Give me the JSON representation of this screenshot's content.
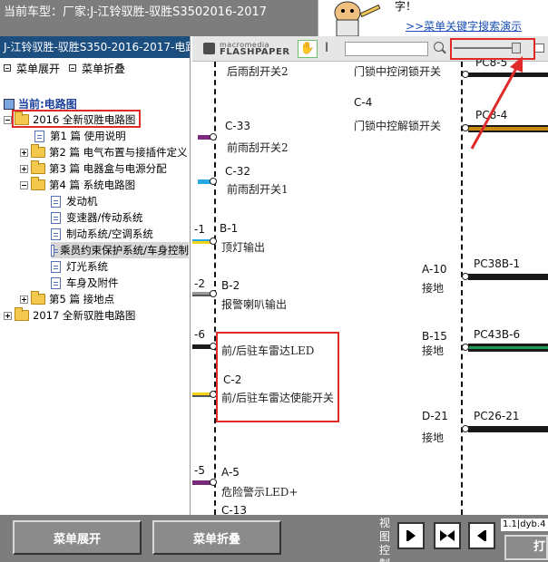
{
  "window": {
    "title": "当前车型：厂家:J-江铃驭胜-驭胜S3502016-2017"
  },
  "banner": {
    "tip": "字！",
    "link": ">>菜单关键字搜索演示"
  },
  "left_panel": {
    "header": "J-江铃驭胜-驭胜S350-2016-2017-电路",
    "expand_label": "菜单展开",
    "collapse_label": "菜单折叠",
    "current_label": "当前:电路图",
    "tree": [
      {
        "label": "2016 全新驭胜电路图"
      },
      {
        "label": "第1 篇 使用说明"
      },
      {
        "label": "第2 篇 电气布置与接插件定义"
      },
      {
        "label": "第3 篇 电器盒与电源分配"
      },
      {
        "label": "第4 篇 系统电路图"
      },
      {
        "label": "发动机"
      },
      {
        "label": "变速器/传动系统"
      },
      {
        "label": "制动系统/空调系统"
      },
      {
        "label": "乘员约束保护系统/车身控制"
      },
      {
        "label": "灯光系统"
      },
      {
        "label": "车身及附件"
      },
      {
        "label": "第5 篇 接地点"
      },
      {
        "label": "2017 全新驭胜电路图"
      }
    ]
  },
  "viewer": {
    "logo_top": "macromedia",
    "logo_main": "FLASHPAPER",
    "cursor_glyph": "I"
  },
  "diagram": {
    "left_codes": [
      "C-33",
      "C-32",
      "B-1",
      "B-2",
      "C-2",
      "A-5",
      "C-13"
    ],
    "left_labels": [
      "后雨刮开关2",
      "前雨刮开关2",
      "前雨刮开关1",
      "顶灯输出",
      "报警喇叭输出",
      "前/后驻车雷达LED",
      "前/后驻车雷达使能开关",
      "危险警示LED+"
    ],
    "pin_numbers": [
      "-1",
      "-2",
      "-6",
      "-5"
    ],
    "mid_codes": [
      "C-4",
      "A-10",
      "B-15",
      "D-21"
    ],
    "mid_labels": [
      "门锁中控闭锁开关",
      "门锁中控解锁开关",
      "接地",
      "接地",
      "接地"
    ],
    "wire_codes": [
      "PC8-5",
      "PC8-4",
      "PC38B-1",
      "PC43B-6",
      "PC26-21"
    ],
    "colors": {
      "purple": "#7a2a7a",
      "cyan": "#25a9e0",
      "yellow": "#f2d21b",
      "gray": "#9a9a9a",
      "black": "#1a1a1a",
      "orange": "#c98a12",
      "green": "#1e9a55",
      "red_annotation": "#e02a2a"
    }
  },
  "bottom_bar": {
    "expand_button": "菜单展开",
    "collapse_button": "菜单折叠",
    "view_control": "视图控制",
    "page_info": "1.1|dyb.4",
    "print_button": "打"
  }
}
